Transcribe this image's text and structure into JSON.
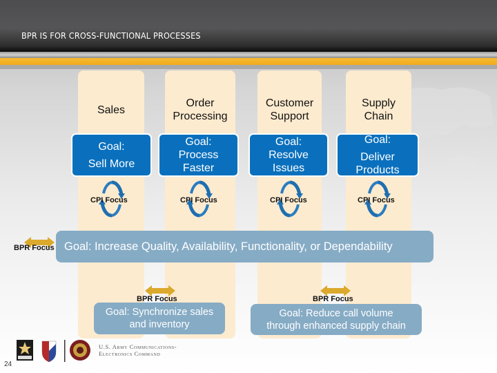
{
  "header": {
    "title": "BPR IS FOR CROSS-FUNCTIONAL PROCESSES"
  },
  "colors": {
    "gold": "#f1ab1e",
    "column": "#fdebcf",
    "goal_blue": "#0a70bd",
    "banner_blue": "#86abc5",
    "cycle_blue": "#1f6fb0",
    "arrow_gold": "#dba92c"
  },
  "columns": [
    {
      "title": [
        "Sales"
      ],
      "goal": [
        "Goal:",
        "Sell More"
      ],
      "cpi": "CPI Focus"
    },
    {
      "title": [
        "Order",
        "Processing"
      ],
      "goal": [
        "Goal:",
        "Process",
        "Faster"
      ],
      "cpi": "CPI Focus"
    },
    {
      "title": [
        "Customer",
        "Support"
      ],
      "goal": [
        "Goal:",
        "Resolve",
        "Issues"
      ],
      "cpi": "CPI Focus"
    },
    {
      "title": [
        "Supply",
        "Chain"
      ],
      "goal": [
        "Goal:",
        "Deliver",
        "Products"
      ],
      "cpi": "CPI Focus"
    }
  ],
  "bpr_left": {
    "label": "BPR Focus"
  },
  "banner": {
    "text": "Goal: Increase Quality, Availability, Functionality, or Dependability"
  },
  "bpr_pairs": [
    {
      "label": "BPR Focus",
      "goal": [
        "Goal: Synchronize sales",
        "and inventory"
      ]
    },
    {
      "label": "BPR Focus",
      "goal": [
        "Goal: Reduce call volume",
        "through enhanced supply chain"
      ]
    }
  ],
  "footer": {
    "page_number": "24",
    "org_line1": "U.S. Army Communications-",
    "org_line2": "Electronics Command",
    "logo_badge": "U.S.ARMY"
  }
}
